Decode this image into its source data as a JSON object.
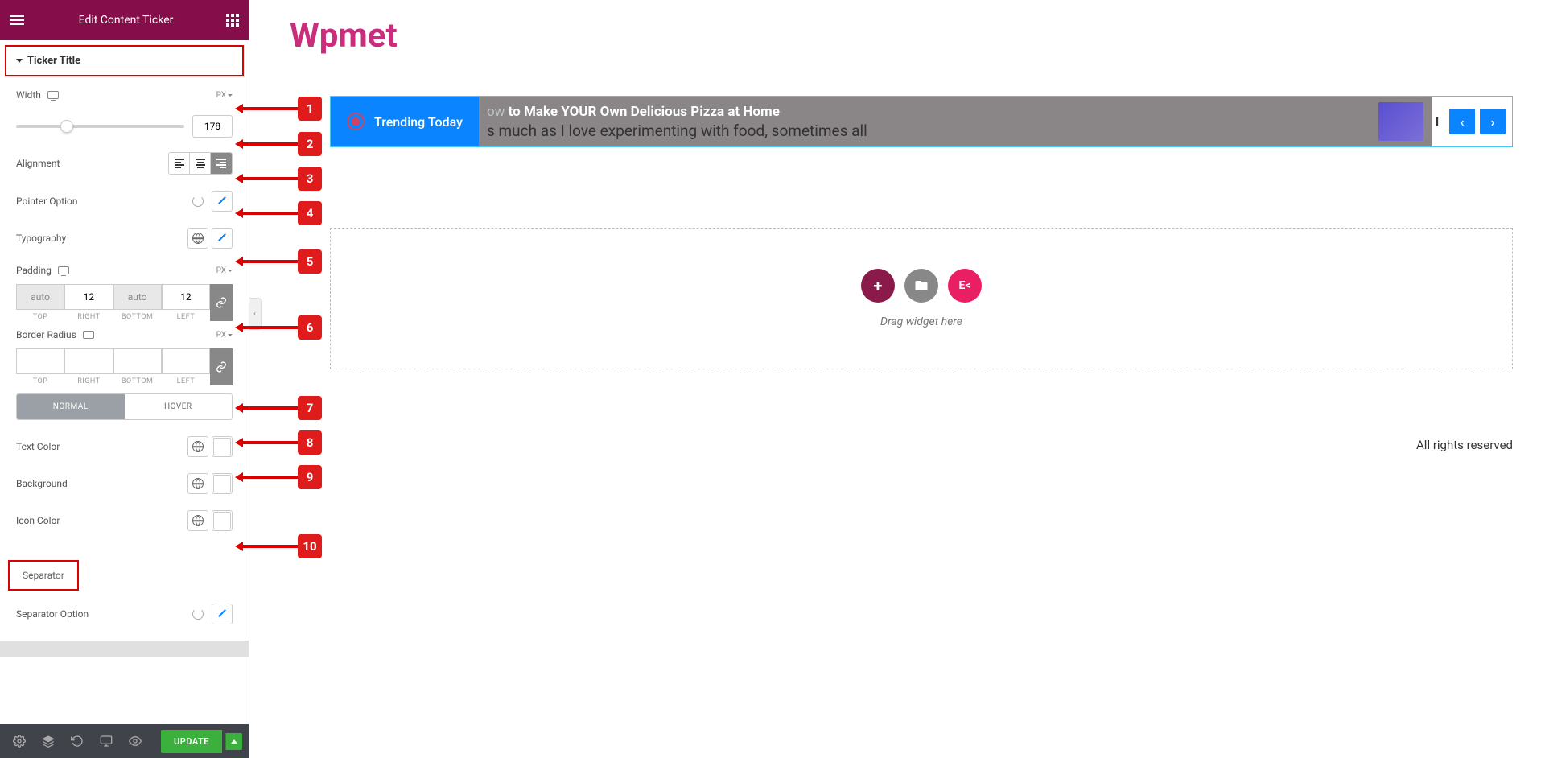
{
  "header": {
    "title": "Edit Content Ticker"
  },
  "sections": {
    "ticker_title": "Ticker Title",
    "separator": "Separator"
  },
  "controls": {
    "width_label": "Width",
    "width_unit": "PX",
    "width_value": "178",
    "alignment_label": "Alignment",
    "pointer_label": "Pointer Option",
    "typography_label": "Typography",
    "padding_label": "Padding",
    "padding_unit": "PX",
    "padding": {
      "top": "auto",
      "right": "12",
      "bottom": "auto",
      "left": "12"
    },
    "padding_sides": {
      "top": "TOP",
      "right": "RIGHT",
      "bottom": "BOTTOM",
      "left": "LEFT"
    },
    "border_radius_label": "Border Radius",
    "border_radius_unit": "PX",
    "tabs": {
      "normal": "NORMAL",
      "hover": "HOVER"
    },
    "text_color_label": "Text Color",
    "background_label": "Background",
    "background_color": "#0a84ff",
    "icon_color_label": "Icon Color",
    "separator_option_label": "Separator Option"
  },
  "footer": {
    "update": "UPDATE"
  },
  "preview": {
    "brand": "Wpmet",
    "ticker_title": "Trending Today",
    "headline_prefix": "ow ",
    "headline": "to Make YOUR Own Delicious Pizza at Home",
    "subline": "s much as I love experimenting with food, sometimes all",
    "peek": "I",
    "drop_text": "Drag widget here",
    "ek_label": "E<",
    "rights": "All rights reserved"
  },
  "annotations": {
    "n1": "1",
    "n2": "2",
    "n3": "3",
    "n4": "4",
    "n5": "5",
    "n6": "6",
    "n7": "7",
    "n8": "8",
    "n9": "9",
    "n10": "10"
  }
}
